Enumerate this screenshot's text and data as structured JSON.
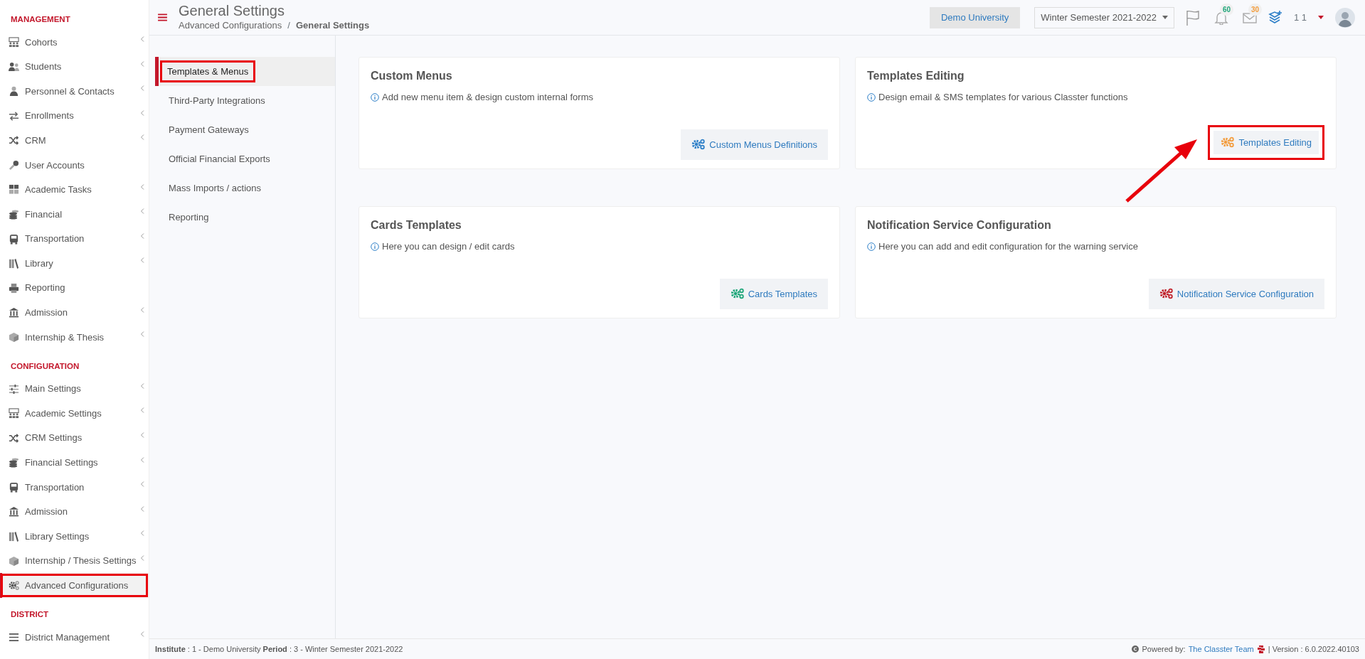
{
  "sidebar": {
    "sections": [
      {
        "title": "MANAGEMENT",
        "items": [
          {
            "label": "Cohorts",
            "expandable": true,
            "selected": false,
            "highlighted": false
          },
          {
            "label": "Students",
            "expandable": true,
            "selected": false,
            "highlighted": false
          },
          {
            "label": "Personnel & Contacts",
            "expandable": true,
            "selected": false,
            "highlighted": false
          },
          {
            "label": "Enrollments",
            "expandable": true,
            "selected": false,
            "highlighted": false
          },
          {
            "label": "CRM",
            "expandable": true,
            "selected": false,
            "highlighted": false
          },
          {
            "label": "User Accounts",
            "expandable": false,
            "selected": false,
            "highlighted": false
          },
          {
            "label": "Academic Tasks",
            "expandable": true,
            "selected": false,
            "highlighted": false
          },
          {
            "label": "Financial",
            "expandable": true,
            "selected": false,
            "highlighted": false
          },
          {
            "label": "Transportation",
            "expandable": true,
            "selected": false,
            "highlighted": false
          },
          {
            "label": "Library",
            "expandable": true,
            "selected": false,
            "highlighted": false
          },
          {
            "label": "Reporting",
            "expandable": false,
            "selected": false,
            "highlighted": false
          },
          {
            "label": "Admission",
            "expandable": true,
            "selected": false,
            "highlighted": false
          },
          {
            "label": "Internship & Thesis",
            "expandable": true,
            "selected": false,
            "highlighted": false
          }
        ]
      },
      {
        "title": "CONFIGURATION",
        "items": [
          {
            "label": "Main Settings",
            "expandable": true,
            "selected": false,
            "highlighted": false
          },
          {
            "label": "Academic Settings",
            "expandable": true,
            "selected": false,
            "highlighted": false
          },
          {
            "label": "CRM Settings",
            "expandable": true,
            "selected": false,
            "highlighted": false
          },
          {
            "label": "Financial Settings",
            "expandable": true,
            "selected": false,
            "highlighted": false
          },
          {
            "label": "Transportation",
            "expandable": true,
            "selected": false,
            "highlighted": false
          },
          {
            "label": "Admission",
            "expandable": true,
            "selected": false,
            "highlighted": false
          },
          {
            "label": "Library Settings",
            "expandable": true,
            "selected": false,
            "highlighted": false
          },
          {
            "label": "Internship / Thesis Settings",
            "expandable": true,
            "selected": false,
            "highlighted": false
          },
          {
            "label": "Advanced Configurations",
            "expandable": false,
            "selected": true,
            "highlighted": true
          }
        ]
      },
      {
        "title": "DISTRICT",
        "items": [
          {
            "label": "District Management",
            "expandable": true,
            "selected": false,
            "highlighted": false
          }
        ]
      }
    ]
  },
  "header": {
    "title": "General Settings",
    "breadcrumb": [
      {
        "label": "Advanced Configurations",
        "current": false
      },
      {
        "label": "General Settings",
        "current": true
      }
    ],
    "separator": "/",
    "institute": "Demo University",
    "period": "Winter Semester 2021-2022",
    "notifications": "60",
    "messages": "30",
    "user": "1 1"
  },
  "subnav": [
    {
      "label": "Templates & Menus",
      "selected": true,
      "highlighted": true
    },
    {
      "label": "Third-Party Integrations",
      "selected": false,
      "highlighted": false
    },
    {
      "label": "Payment Gateways",
      "selected": false,
      "highlighted": false
    },
    {
      "label": "Official Financial Exports",
      "selected": false,
      "highlighted": false
    },
    {
      "label": "Mass Imports / actions",
      "selected": false,
      "highlighted": false
    },
    {
      "label": "Reporting",
      "selected": false,
      "highlighted": false
    }
  ],
  "cards": [
    {
      "title": "Custom Menus",
      "description": "Add new menu item & design custom internal forms",
      "button": "Custom Menus Definitions",
      "color": "#2f80c8",
      "highlighted": false,
      "pointed": false
    },
    {
      "title": "Templates Editing",
      "description": "Design email & SMS templates for various Classter functions",
      "button": "Templates Editing",
      "color": "#f39c3c",
      "highlighted": true,
      "pointed": true
    },
    {
      "title": "Cards Templates",
      "description": "Here you can design / edit cards",
      "button": "Cards Templates",
      "color": "#1fa67a",
      "highlighted": false,
      "pointed": false
    },
    {
      "title": "Notification Service Configuration",
      "description": "Here you can add and edit configuration for the warning service",
      "button": "Notification Service Configuration",
      "color": "#c0222b",
      "highlighted": false,
      "pointed": false
    }
  ],
  "footer": {
    "info": "**Institute** : 1 - Demo University **Period** : 3 - Winter Semester 2021-2022",
    "powered": "Powered by:",
    "team": "The Classter Team",
    "version": "| Version : 6.0.2022.40103"
  }
}
